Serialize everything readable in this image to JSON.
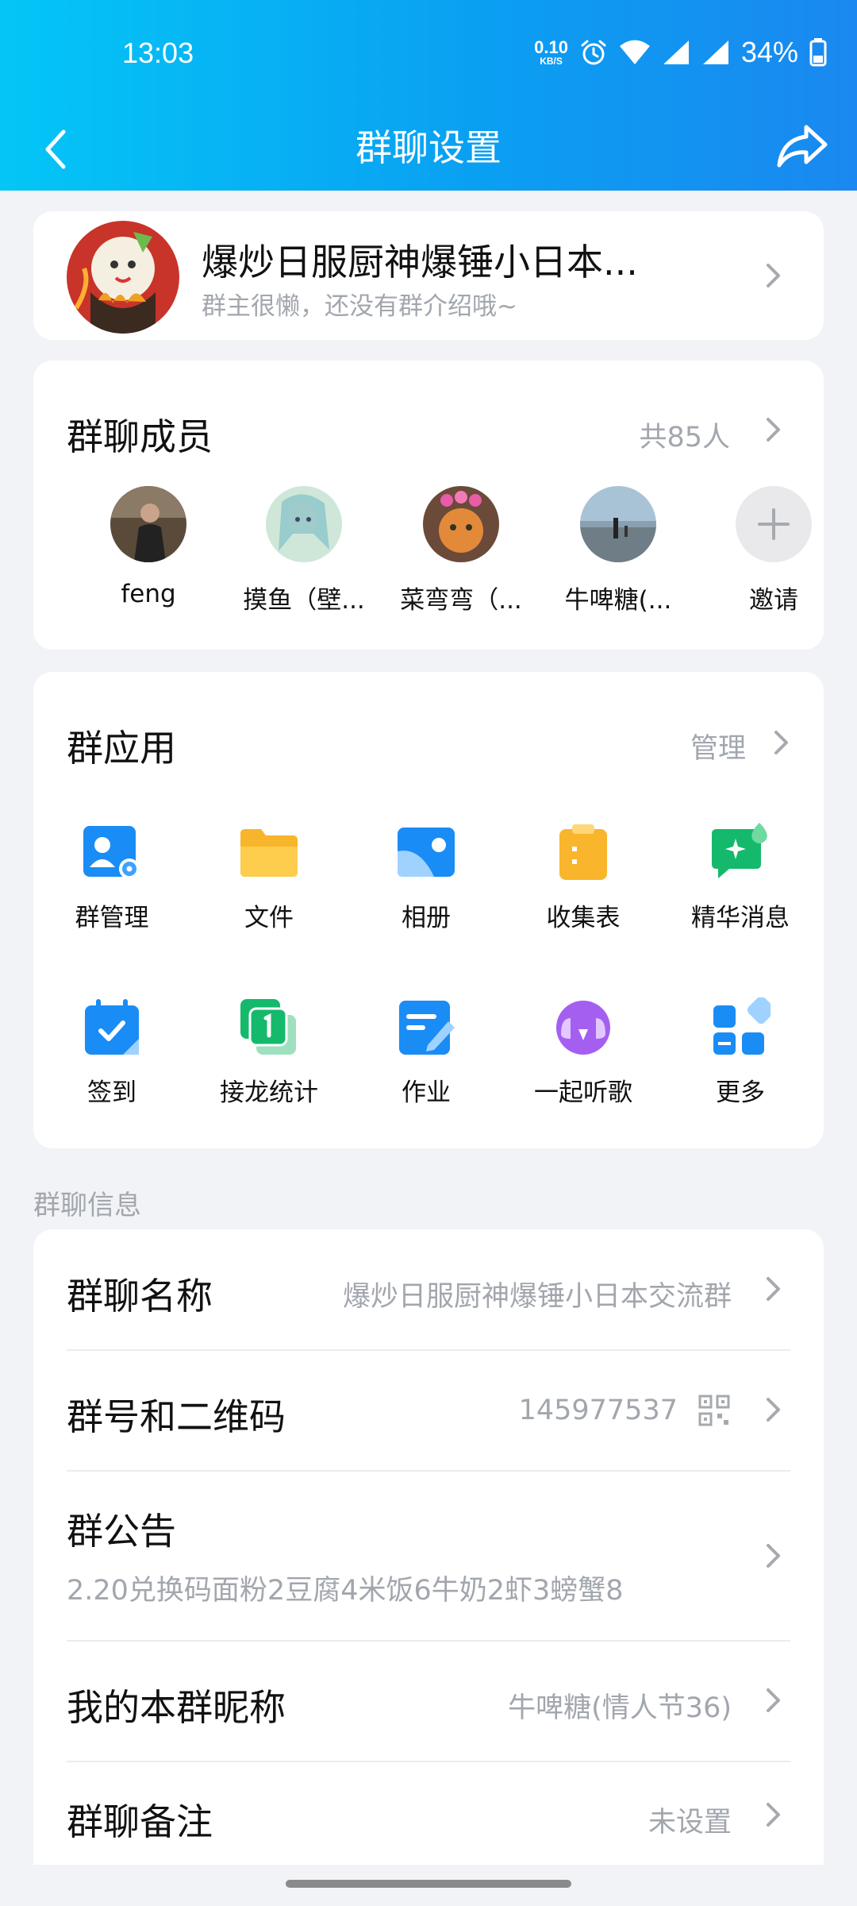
{
  "status_bar": {
    "time": "13:03",
    "net_speed_value": "0.10",
    "net_speed_unit": "KB/S",
    "battery": "34%"
  },
  "nav": {
    "title": "群聊设置"
  },
  "group": {
    "name": "爆炒日服厨神爆锤小日本...",
    "intro": "群主很懒，还没有群介绍哦~"
  },
  "members": {
    "title": "群聊成员",
    "count": "共85人",
    "items": [
      {
        "name": "feng"
      },
      {
        "name": "摸鱼（壁..."
      },
      {
        "name": "菜弯弯（..."
      },
      {
        "name": "牛啤糖(..."
      },
      {
        "name": "邀请"
      }
    ]
  },
  "apps": {
    "title": "群应用",
    "manage": "管理",
    "items": [
      {
        "label": "群管理",
        "icon": "group-manage-icon"
      },
      {
        "label": "文件",
        "icon": "folder-icon"
      },
      {
        "label": "相册",
        "icon": "album-icon"
      },
      {
        "label": "收集表",
        "icon": "clipboard-icon"
      },
      {
        "label": "精华消息",
        "icon": "essence-message-icon"
      },
      {
        "label": "签到",
        "icon": "checkin-icon"
      },
      {
        "label": "接龙统计",
        "icon": "relay-stats-icon"
      },
      {
        "label": "作业",
        "icon": "homework-icon"
      },
      {
        "label": "一起听歌",
        "icon": "listen-together-icon"
      },
      {
        "label": "更多",
        "icon": "more-apps-icon"
      }
    ]
  },
  "info": {
    "section_label": "群聊信息",
    "name_label": "群聊名称",
    "name_value": "爆炒日服厨神爆锤小日本交流群",
    "number_label": "群号和二维码",
    "number_value": "145977537",
    "notice_label": "群公告",
    "notice_value": "2.20兑换码面粉2豆腐4米饭6牛奶2虾3螃蟹8",
    "nickname_label": "我的本群昵称",
    "nickname_value": "牛啤糖(情人节36)",
    "remark_label": "群聊备注",
    "remark_value": "未设置"
  },
  "colors": {
    "header_start": "#04c6f6",
    "header_end": "#1a88f0",
    "background": "#f2f3f7",
    "secondary_text": "#a2a6ad"
  }
}
